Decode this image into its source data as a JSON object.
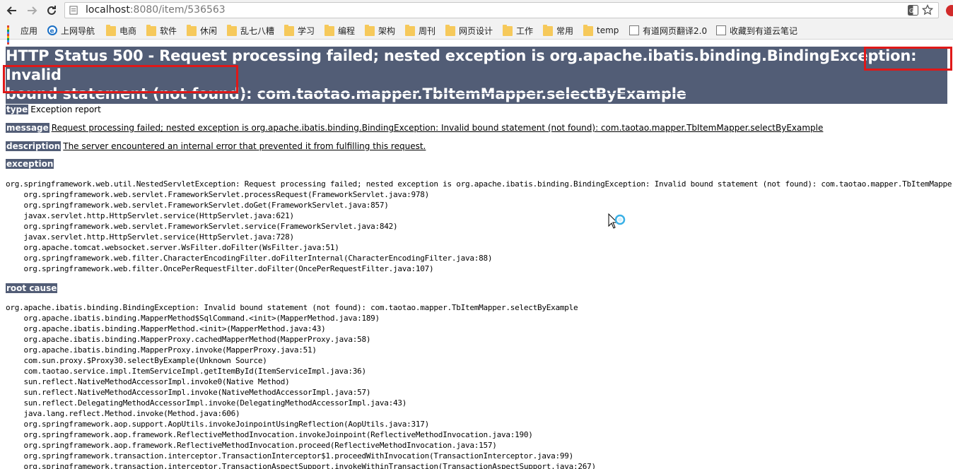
{
  "browser": {
    "url_host": "localhost",
    "url_rest": ":8080/item/536563",
    "bookmarks": [
      {
        "label": "应用",
        "icon": "apps-icon"
      },
      {
        "label": "上网导航",
        "icon": "ie-icon"
      },
      {
        "label": "电商",
        "icon": "folder-icon"
      },
      {
        "label": "软件",
        "icon": "folder-icon"
      },
      {
        "label": "休闲",
        "icon": "folder-icon"
      },
      {
        "label": "乱七八糟",
        "icon": "folder-icon"
      },
      {
        "label": "学习",
        "icon": "folder-icon"
      },
      {
        "label": "编程",
        "icon": "folder-icon"
      },
      {
        "label": "架构",
        "icon": "folder-icon"
      },
      {
        "label": "周刊",
        "icon": "folder-icon"
      },
      {
        "label": "网页设计",
        "icon": "folder-icon"
      },
      {
        "label": "工作",
        "icon": "folder-icon"
      },
      {
        "label": "常用",
        "icon": "folder-icon"
      },
      {
        "label": "temp",
        "icon": "folder-icon"
      },
      {
        "label": "有道网页翻译2.0",
        "icon": "page-icon"
      },
      {
        "label": "收藏到有道云笔记",
        "icon": "page-icon"
      }
    ]
  },
  "error_page": {
    "title_line1": "HTTP Status 500 - Request processing failed; nested exception is org.apache.ibatis.binding.BindingException: Invalid",
    "title_line2": "bound statement (not found): com.taotao.mapper.TbItemMapper.selectByExample",
    "type_label": "type",
    "type_value": "Exception report",
    "message_label": "message",
    "message_value": "Request processing failed; nested exception is org.apache.ibatis.binding.BindingException: Invalid bound statement (not found): com.taotao.mapper.TbItemMapper.selectByExample",
    "description_label": "description",
    "description_value": "The server encountered an internal error that prevented it from fulfilling this request.",
    "exception_label": "exception",
    "exception_trace": "org.springframework.web.util.NestedServletException: Request processing failed; nested exception is org.apache.ibatis.binding.BindingException: Invalid bound statement (not found): com.taotao.mapper.TbItemMapper.selectByExample\n\torg.springframework.web.servlet.FrameworkServlet.processRequest(FrameworkServlet.java:978)\n\torg.springframework.web.servlet.FrameworkServlet.doGet(FrameworkServlet.java:857)\n\tjavax.servlet.http.HttpServlet.service(HttpServlet.java:621)\n\torg.springframework.web.servlet.FrameworkServlet.service(FrameworkServlet.java:842)\n\tjavax.servlet.http.HttpServlet.service(HttpServlet.java:728)\n\torg.apache.tomcat.websocket.server.WsFilter.doFilter(WsFilter.java:51)\n\torg.springframework.web.filter.CharacterEncodingFilter.doFilterInternal(CharacterEncodingFilter.java:88)\n\torg.springframework.web.filter.OncePerRequestFilter.doFilter(OncePerRequestFilter.java:107)",
    "root_cause_label": "root cause",
    "root_cause_trace": "org.apache.ibatis.binding.BindingException: Invalid bound statement (not found): com.taotao.mapper.TbItemMapper.selectByExample\n\torg.apache.ibatis.binding.MapperMethod$SqlCommand.<init>(MapperMethod.java:189)\n\torg.apache.ibatis.binding.MapperMethod.<init>(MapperMethod.java:43)\n\torg.apache.ibatis.binding.MapperProxy.cachedMapperMethod(MapperProxy.java:58)\n\torg.apache.ibatis.binding.MapperProxy.invoke(MapperProxy.java:51)\n\tcom.sun.proxy.$Proxy30.selectByExample(Unknown Source)\n\tcom.taotao.service.impl.ItemServiceImpl.getItemById(ItemServiceImpl.java:36)\n\tsun.reflect.NativeMethodAccessorImpl.invoke0(Native Method)\n\tsun.reflect.NativeMethodAccessorImpl.invoke(NativeMethodAccessorImpl.java:57)\n\tsun.reflect.DelegatingMethodAccessorImpl.invoke(DelegatingMethodAccessorImpl.java:43)\n\tjava.lang.reflect.Method.invoke(Method.java:606)\n\torg.springframework.aop.support.AopUtils.invokeJoinpointUsingReflection(AopUtils.java:317)\n\torg.springframework.aop.framework.ReflectiveMethodInvocation.invokeJoinpoint(ReflectiveMethodInvocation.java:190)\n\torg.springframework.aop.framework.ReflectiveMethodInvocation.proceed(ReflectiveMethodInvocation.java:157)\n\torg.springframework.transaction.interceptor.TransactionInterceptor$1.proceedWithInvocation(TransactionInterceptor.java:99)\n\torg.springframework.transaction.interceptor.TransactionAspectSupport.invokeWithinTransaction(TransactionAspectSupport.java:267)"
  },
  "colors": {
    "tomcat_header": "#525d76",
    "highlight_box": "#e01818",
    "chrome_bg": "#f2f2f2"
  }
}
